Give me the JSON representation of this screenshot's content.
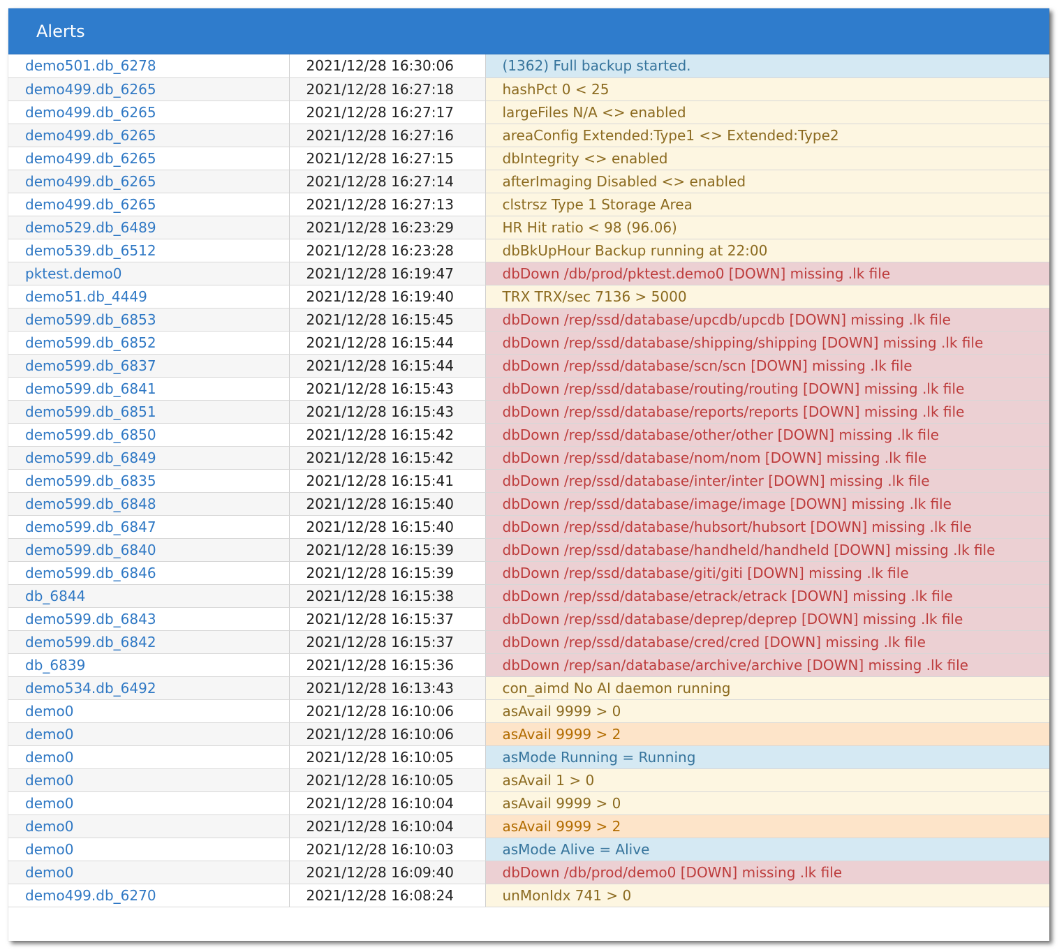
{
  "panel": {
    "title": "Alerts"
  },
  "rows": [
    {
      "db": "demo501.db_6278",
      "time": "2021/12/28 16:30:06",
      "message": "(1362) Full backup started.",
      "severity": "info"
    },
    {
      "db": "demo499.db_6265",
      "time": "2021/12/28 16:27:18",
      "message": "hashPct 0 < 25",
      "severity": "warn"
    },
    {
      "db": "demo499.db_6265",
      "time": "2021/12/28 16:27:17",
      "message": "largeFiles N/A <> enabled",
      "severity": "warn"
    },
    {
      "db": "demo499.db_6265",
      "time": "2021/12/28 16:27:16",
      "message": "areaConfig Extended:Type1 <> Extended:Type2",
      "severity": "warn"
    },
    {
      "db": "demo499.db_6265",
      "time": "2021/12/28 16:27:15",
      "message": "dbIntegrity <> enabled",
      "severity": "warn"
    },
    {
      "db": "demo499.db_6265",
      "time": "2021/12/28 16:27:14",
      "message": "afterImaging Disabled <> enabled",
      "severity": "warn"
    },
    {
      "db": "demo499.db_6265",
      "time": "2021/12/28 16:27:13",
      "message": "clstrsz Type 1 Storage Area",
      "severity": "warn"
    },
    {
      "db": "demo529.db_6489",
      "time": "2021/12/28 16:23:29",
      "message": "HR Hit ratio < 98 (96.06)",
      "severity": "warn"
    },
    {
      "db": "demo539.db_6512",
      "time": "2021/12/28 16:23:28",
      "message": "dbBkUpHour Backup running at 22:00",
      "severity": "warn"
    },
    {
      "db": "pktest.demo0",
      "time": "2021/12/28 16:19:47",
      "message": "dbDown /db/prod/pktest.demo0 [DOWN] missing .lk file",
      "severity": "error"
    },
    {
      "db": "demo51.db_4449",
      "time": "2021/12/28 16:19:40",
      "message": "TRX TRX/sec 7136 > 5000",
      "severity": "warn"
    },
    {
      "db": "demo599.db_6853",
      "time": "2021/12/28 16:15:45",
      "message": "dbDown /rep/ssd/database/upcdb/upcdb [DOWN] missing .lk file",
      "severity": "error"
    },
    {
      "db": "demo599.db_6852",
      "time": "2021/12/28 16:15:44",
      "message": "dbDown /rep/ssd/database/shipping/shipping [DOWN] missing .lk file",
      "severity": "error"
    },
    {
      "db": "demo599.db_6837",
      "time": "2021/12/28 16:15:44",
      "message": "dbDown /rep/ssd/database/scn/scn [DOWN] missing .lk file",
      "severity": "error"
    },
    {
      "db": "demo599.db_6841",
      "time": "2021/12/28 16:15:43",
      "message": "dbDown /rep/ssd/database/routing/routing [DOWN] missing .lk file",
      "severity": "error"
    },
    {
      "db": "demo599.db_6851",
      "time": "2021/12/28 16:15:43",
      "message": "dbDown /rep/ssd/database/reports/reports [DOWN] missing .lk file",
      "severity": "error"
    },
    {
      "db": "demo599.db_6850",
      "time": "2021/12/28 16:15:42",
      "message": "dbDown /rep/ssd/database/other/other [DOWN] missing .lk file",
      "severity": "error"
    },
    {
      "db": "demo599.db_6849",
      "time": "2021/12/28 16:15:42",
      "message": "dbDown /rep/ssd/database/nom/nom [DOWN] missing .lk file",
      "severity": "error"
    },
    {
      "db": "demo599.db_6835",
      "time": "2021/12/28 16:15:41",
      "message": "dbDown /rep/ssd/database/inter/inter [DOWN] missing .lk file",
      "severity": "error"
    },
    {
      "db": "demo599.db_6848",
      "time": "2021/12/28 16:15:40",
      "message": "dbDown /rep/ssd/database/image/image [DOWN] missing .lk file",
      "severity": "error"
    },
    {
      "db": "demo599.db_6847",
      "time": "2021/12/28 16:15:40",
      "message": "dbDown /rep/ssd/database/hubsort/hubsort [DOWN] missing .lk file",
      "severity": "error"
    },
    {
      "db": "demo599.db_6840",
      "time": "2021/12/28 16:15:39",
      "message": "dbDown /rep/ssd/database/handheld/handheld [DOWN] missing .lk file",
      "severity": "error"
    },
    {
      "db": "demo599.db_6846",
      "time": "2021/12/28 16:15:39",
      "message": "dbDown /rep/ssd/database/giti/giti [DOWN] missing .lk file",
      "severity": "error"
    },
    {
      "db": "db_6844",
      "time": "2021/12/28 16:15:38",
      "message": "dbDown /rep/ssd/database/etrack/etrack [DOWN] missing .lk file",
      "severity": "error"
    },
    {
      "db": "demo599.db_6843",
      "time": "2021/12/28 16:15:37",
      "message": "dbDown /rep/ssd/database/deprep/deprep [DOWN] missing .lk file",
      "severity": "error"
    },
    {
      "db": "demo599.db_6842",
      "time": "2021/12/28 16:15:37",
      "message": "dbDown /rep/ssd/database/cred/cred [DOWN] missing .lk file",
      "severity": "error"
    },
    {
      "db": "db_6839",
      "time": "2021/12/28 16:15:36",
      "message": "dbDown /rep/san/database/archive/archive [DOWN] missing .lk file",
      "severity": "error"
    },
    {
      "db": "demo534.db_6492",
      "time": "2021/12/28 16:13:43",
      "message": "con_aimd No AI daemon running",
      "severity": "warn"
    },
    {
      "db": "demo0",
      "time": "2021/12/28 16:10:06",
      "message": "asAvail 9999 > 0",
      "severity": "warn"
    },
    {
      "db": "demo0",
      "time": "2021/12/28 16:10:06",
      "message": "asAvail 9999 > 2",
      "severity": "orange"
    },
    {
      "db": "demo0",
      "time": "2021/12/28 16:10:05",
      "message": "asMode Running = Running",
      "severity": "info"
    },
    {
      "db": "demo0",
      "time": "2021/12/28 16:10:05",
      "message": "asAvail 1 > 0",
      "severity": "warn"
    },
    {
      "db": "demo0",
      "time": "2021/12/28 16:10:04",
      "message": "asAvail 9999 > 0",
      "severity": "warn"
    },
    {
      "db": "demo0",
      "time": "2021/12/28 16:10:04",
      "message": "asAvail 9999 > 2",
      "severity": "orange"
    },
    {
      "db": "demo0",
      "time": "2021/12/28 16:10:03",
      "message": "asMode Alive = Alive",
      "severity": "info"
    },
    {
      "db": "demo0",
      "time": "2021/12/28 16:09:40",
      "message": "dbDown /db/prod/demo0 [DOWN] missing .lk file",
      "severity": "error"
    },
    {
      "db": "demo499.db_6270",
      "time": "2021/12/28 16:08:24",
      "message": "unMonIdx 741 > 0",
      "severity": "warn"
    }
  ],
  "colors": {
    "header_bg": "#2f7ccc",
    "link": "#2f78c4",
    "info_bg": "#d5e9f3",
    "warn_bg": "#fdf6e1",
    "error_bg": "#ecd0d3",
    "orange_bg": "#fde4c9"
  }
}
